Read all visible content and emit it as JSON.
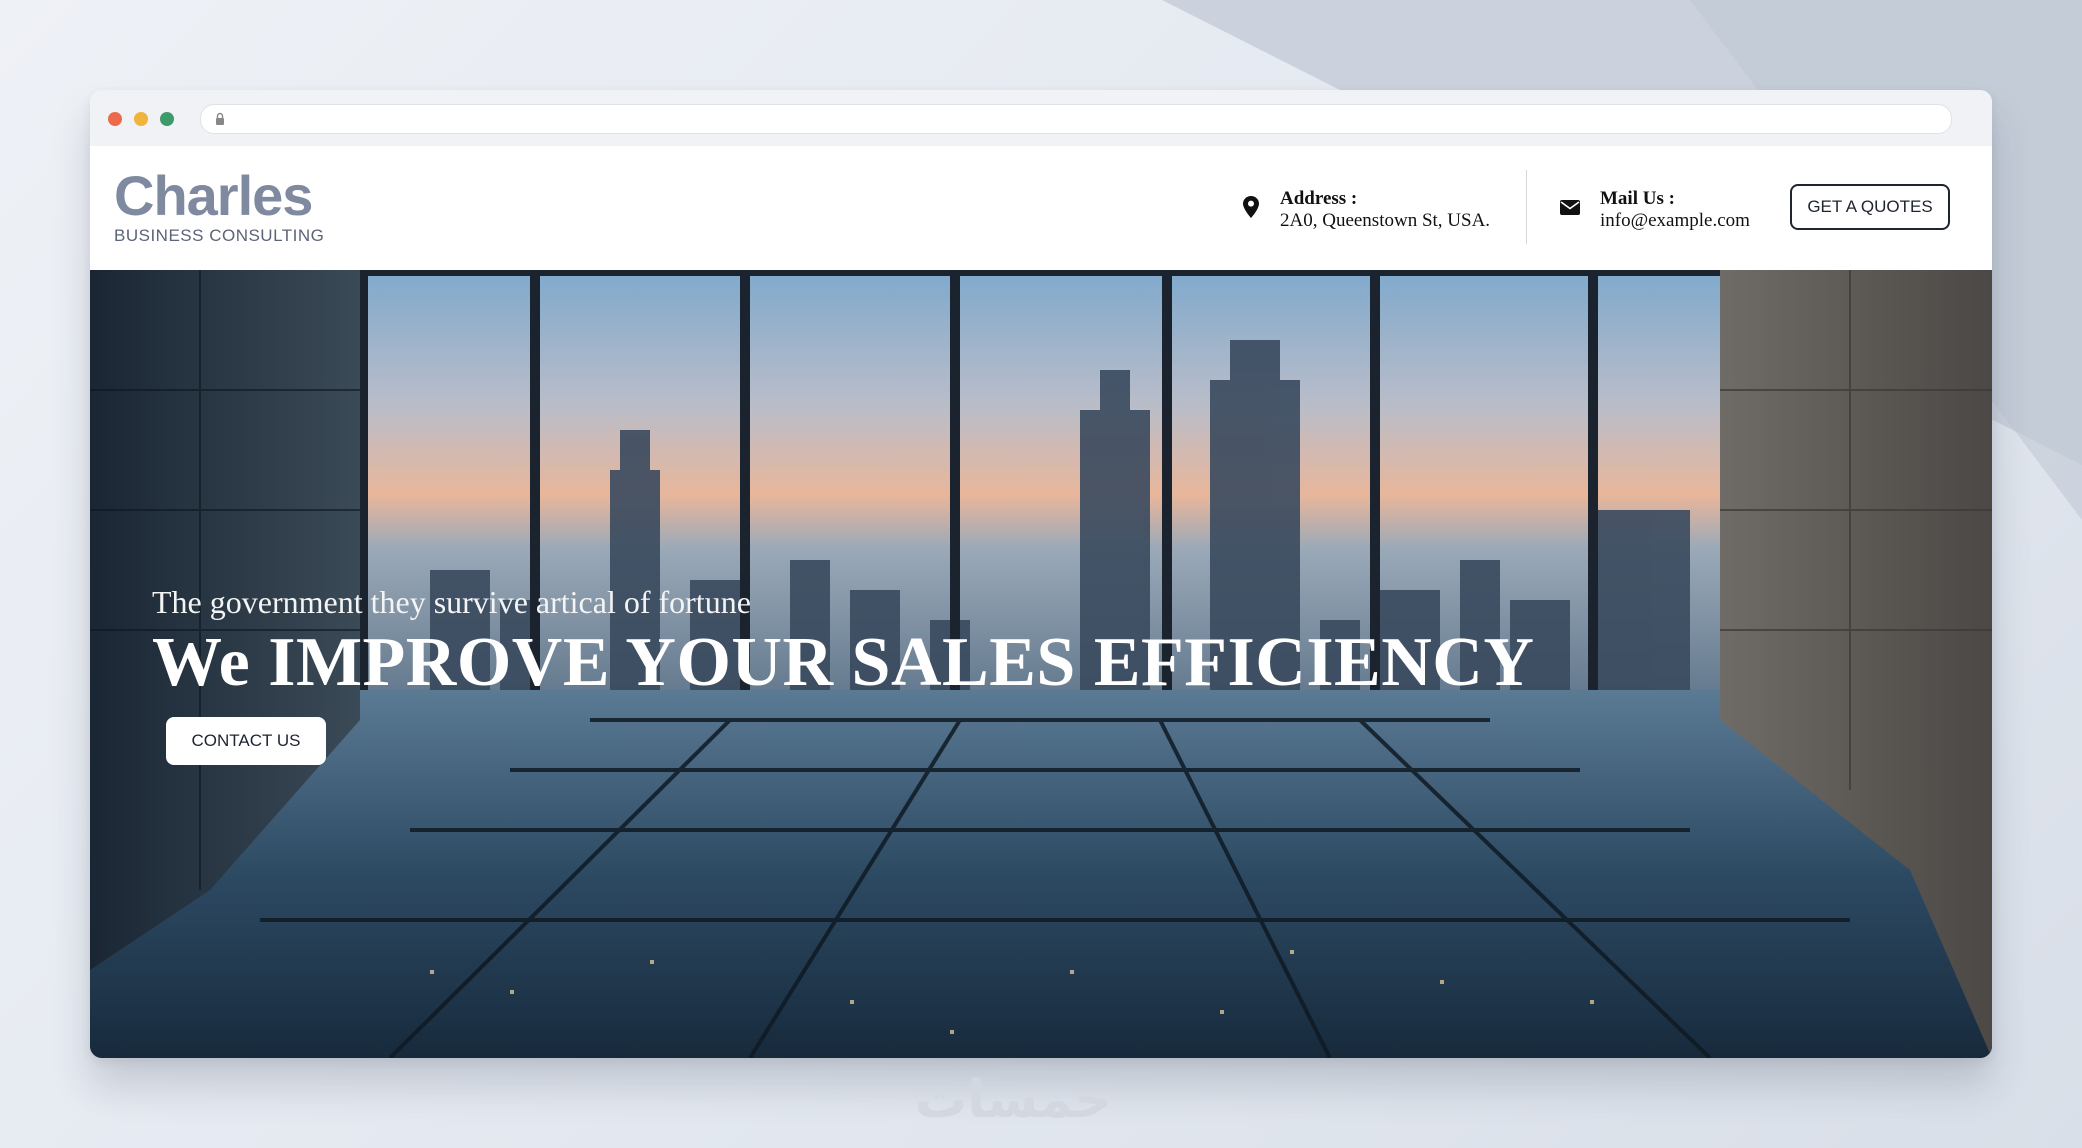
{
  "brand": {
    "logo_text": "Charles",
    "tagline": "BUSINESS CONSULTING"
  },
  "header": {
    "address_label": "Address :",
    "address_value": "2A0, Queenstown St, USA.",
    "mail_label": "Mail Us :",
    "mail_value": "info@example.com",
    "quote_button": "GET A QUOTES"
  },
  "hero": {
    "subtitle": "The government they survive artical of fortune",
    "title": "We IMPROVE YOUR SALES EFFICIENCY",
    "cta_button": "CONTACT US"
  },
  "watermark": "خمسات",
  "icons": {
    "address": "map-pin-icon",
    "mail": "envelope-icon",
    "url": "lock-icon"
  }
}
